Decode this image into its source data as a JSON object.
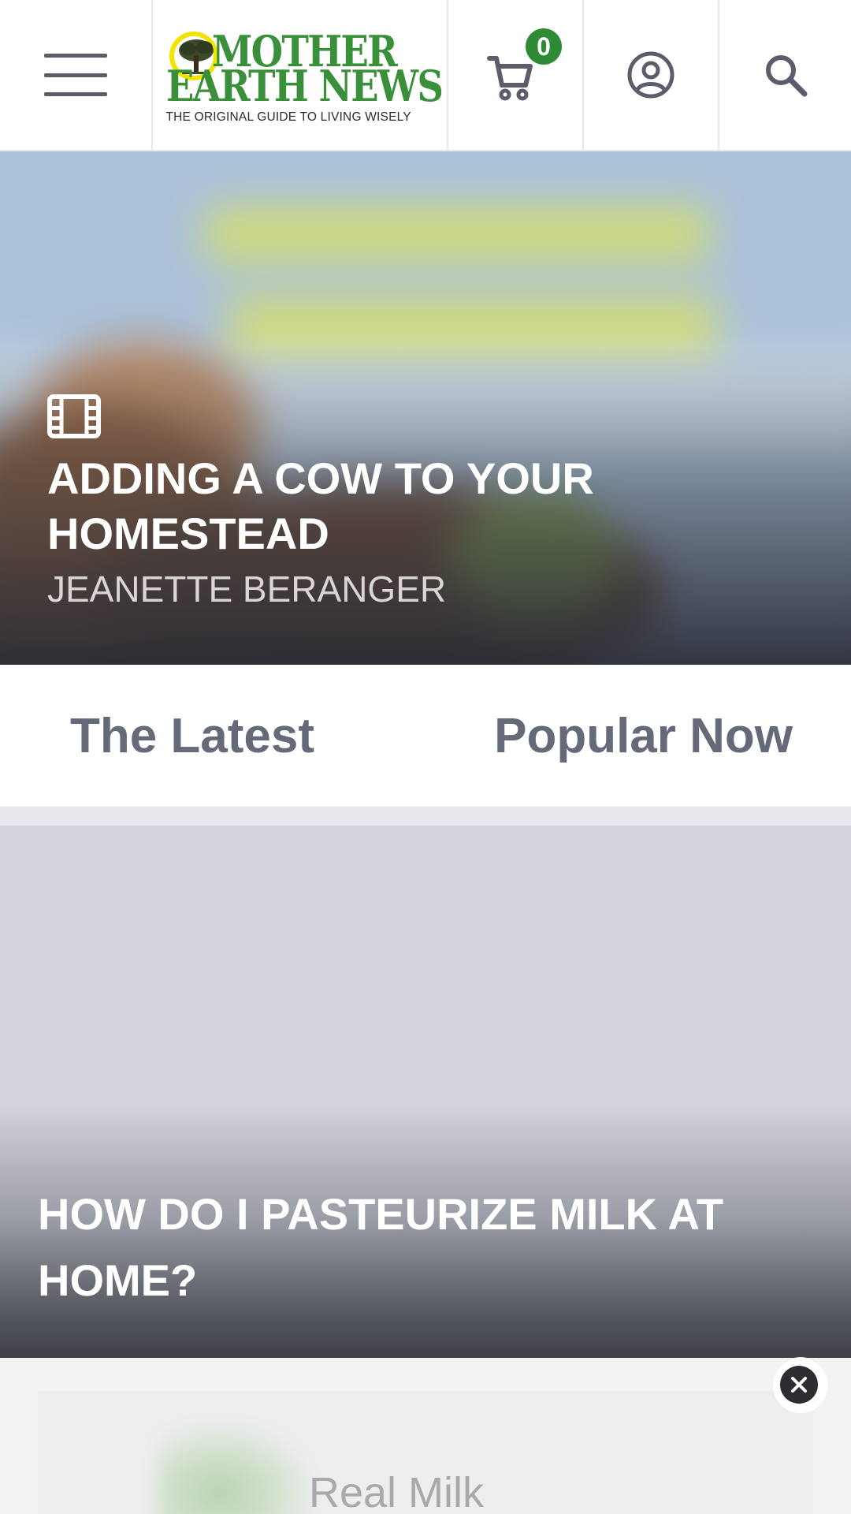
{
  "header": {
    "menu_icon": "hamburger-menu-icon",
    "logo": {
      "line1": "MOTHER",
      "line2": "EARTH NEWS",
      "tagline": "THE ORIGINAL GUIDE TO LIVING WISELY"
    },
    "cart": {
      "icon": "cart-icon",
      "count": "0"
    },
    "account_icon": "user-circle-icon",
    "search_icon": "search-icon"
  },
  "hero": {
    "media_icon": "film-icon",
    "title": "ADDING A COW TO YOUR HOMESTEAD",
    "author": "JEANETTE BERANGER",
    "image_text": "BEFORE YOU BUY YOUR FIRST COW"
  },
  "tabs": [
    {
      "label": "The Latest"
    },
    {
      "label": "Popular Now"
    }
  ],
  "article": {
    "title": "HOW DO I PASTEURIZE MILK AT HOME?"
  },
  "ad": {
    "text": "Real Milk",
    "close_icon": "close-icon"
  },
  "colors": {
    "brand_green": "#3a8f3a",
    "badge_green": "#2f8a36",
    "tab_text": "#646a78",
    "header_border": "#e6e7ea"
  }
}
